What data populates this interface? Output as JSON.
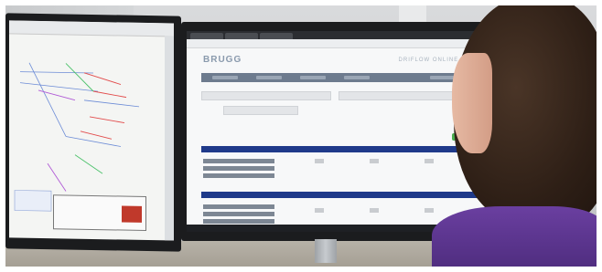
{
  "left_screen": {
    "app": "CAD drawing viewer"
  },
  "right_screen": {
    "site_logo": "BRUGG",
    "site_tagline": "DRIFLOW ONLINE TOOL"
  },
  "colors": {
    "nav": "#6d7b8e",
    "section_bar": "#1f3a8a",
    "button": "#4caf50",
    "shirt": "#5a3590"
  }
}
